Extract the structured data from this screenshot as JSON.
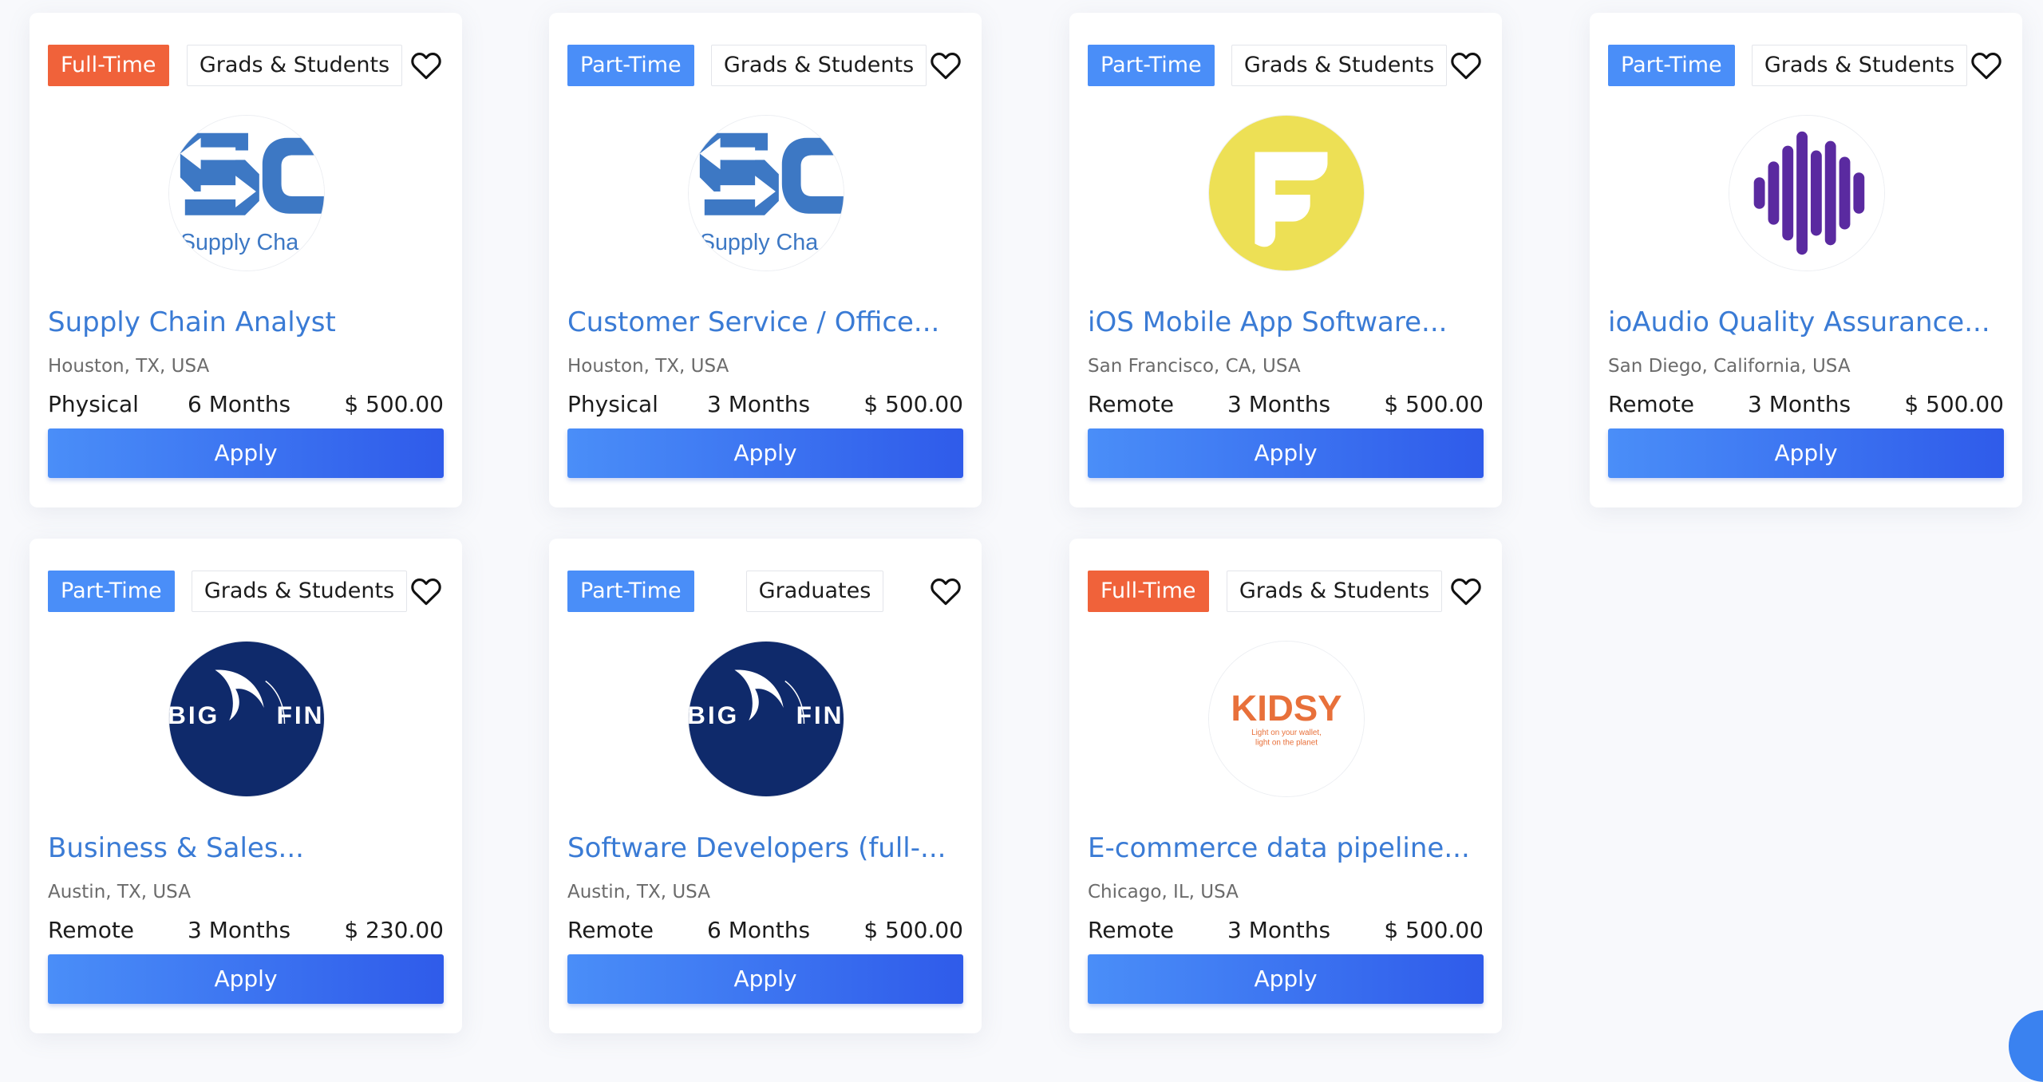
{
  "colors": {
    "full_time": "#f0623a",
    "part_time": "#4a8ef8",
    "title": "#3a7bd5"
  },
  "jobs": [
    {
      "type": "Full-Time",
      "type_color": "#f0623a",
      "audience": "Grads & Students",
      "logo": "supply-chain-logo",
      "title": "Supply Chain Analyst",
      "location": "Houston, TX, USA",
      "work_mode": "Physical",
      "duration": "6 Months",
      "pay": "$ 500.00",
      "apply": "Apply"
    },
    {
      "type": "Part-Time",
      "type_color": "#4a8ef8",
      "audience": "Grads & Students",
      "logo": "supply-chain-logo",
      "title": "Customer Service / Office...",
      "location": "Houston, TX, USA",
      "work_mode": "Physical",
      "duration": "3 Months",
      "pay": "$ 500.00",
      "apply": "Apply"
    },
    {
      "type": "Part-Time",
      "type_color": "#4a8ef8",
      "audience": "Grads & Students",
      "logo": "f-letter-logo",
      "title": "iOS Mobile App Software...",
      "location": "San Francisco, CA, USA",
      "work_mode": "Remote",
      "duration": "3 Months",
      "pay": "$ 500.00",
      "apply": "Apply"
    },
    {
      "type": "Part-Time",
      "type_color": "#4a8ef8",
      "audience": "Grads & Students",
      "logo": "ioaudio-waveform-logo",
      "title": "ioAudio Quality Assurance...",
      "location": "San Diego, California, USA",
      "work_mode": "Remote",
      "duration": "3 Months",
      "pay": "$ 500.00",
      "apply": "Apply"
    },
    {
      "type": "Part-Time",
      "type_color": "#4a8ef8",
      "audience": "Grads & Students",
      "logo": "big-fin-logo",
      "title": "Business & Sales...",
      "location": "Austin, TX, USA",
      "work_mode": "Remote",
      "duration": "3 Months",
      "pay": "$ 230.00",
      "apply": "Apply"
    },
    {
      "type": "Part-Time",
      "type_color": "#4a8ef8",
      "audience": "Graduates",
      "logo": "big-fin-logo",
      "title": "Software Developers (full-...",
      "location": "Austin, TX, USA",
      "work_mode": "Remote",
      "duration": "6 Months",
      "pay": "$ 500.00",
      "apply": "Apply"
    },
    {
      "type": "Full-Time",
      "type_color": "#f0623a",
      "audience": "Grads & Students",
      "logo": "kidsy-logo",
      "title": "E-commerce data pipeline...",
      "location": "Chicago, IL, USA",
      "work_mode": "Remote",
      "duration": "3 Months",
      "pay": "$ 500.00",
      "apply": "Apply"
    }
  ],
  "logos": {
    "supply_chain": {
      "text": "Supply Cha"
    },
    "big_fin": {
      "left_text": "BIG",
      "right_text": "FIN"
    },
    "kidsy": {
      "name": "KIDSY",
      "tagline_1": "Light on your wallet,",
      "tagline_2": "light on the planet"
    }
  }
}
